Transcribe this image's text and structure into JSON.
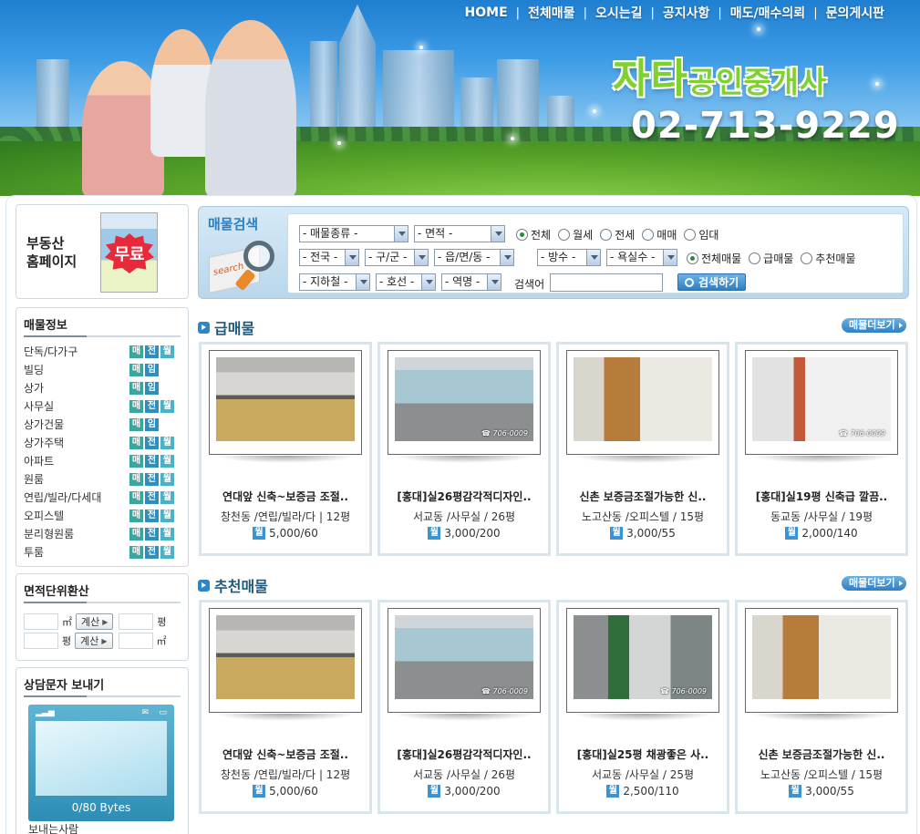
{
  "nav": [
    "HOME",
    "전체매물",
    "오시는길",
    "공지사항",
    "매도/매수의뢰",
    "문의게시판"
  ],
  "brand": {
    "name_big": "자타",
    "name_small": "공인중개사",
    "phone": "02-713-9229"
  },
  "promo": {
    "line1": "부동산",
    "line2": "홈페이지",
    "badge": "무료"
  },
  "info": {
    "title": "매물정보",
    "items": [
      {
        "label": "단독/다가구",
        "tags": [
          "매",
          "전",
          "월"
        ]
      },
      {
        "label": "빌딩",
        "tags": [
          "매",
          "임"
        ]
      },
      {
        "label": "상가",
        "tags": [
          "매",
          "임"
        ]
      },
      {
        "label": "사무실",
        "tags": [
          "매",
          "전",
          "월"
        ]
      },
      {
        "label": "상가건물",
        "tags": [
          "매",
          "임"
        ]
      },
      {
        "label": "상가주택",
        "tags": [
          "매",
          "전",
          "월"
        ]
      },
      {
        "label": "아파트",
        "tags": [
          "매",
          "전",
          "월"
        ]
      },
      {
        "label": "원룸",
        "tags": [
          "매",
          "전",
          "월"
        ]
      },
      {
        "label": "연립/빌라/다세대",
        "tags": [
          "매",
          "전",
          "월"
        ]
      },
      {
        "label": "오피스텔",
        "tags": [
          "매",
          "전",
          "월"
        ]
      },
      {
        "label": "분리형원룸",
        "tags": [
          "매",
          "전",
          "월"
        ]
      },
      {
        "label": "투룸",
        "tags": [
          "매",
          "전",
          "월"
        ]
      }
    ]
  },
  "converter": {
    "title": "면적단위환산",
    "unit_m2": "㎡",
    "unit_py": "평",
    "calc": "계산"
  },
  "sms": {
    "title": "상담문자 보내기",
    "bytes": "0/80 Bytes",
    "sender": "보내는사람"
  },
  "search": {
    "title": "매물검색",
    "art_text": "search",
    "selects_row1": [
      "- 매물종류 -",
      "- 면적 -"
    ],
    "radios_row1": [
      {
        "label": "전체",
        "on": true
      },
      {
        "label": "월세",
        "on": false
      },
      {
        "label": "전세",
        "on": false
      },
      {
        "label": "매매",
        "on": false
      },
      {
        "label": "임대",
        "on": false
      }
    ],
    "selects_row2": [
      "- 전국 -",
      "- 구/군 -",
      "- 읍/면/동 -",
      "- 방수 -",
      "- 욕실수 -"
    ],
    "radios_row2": [
      {
        "label": "전체매물",
        "on": true
      },
      {
        "label": "급매물",
        "on": false
      },
      {
        "label": "추천매물",
        "on": false
      }
    ],
    "selects_row3": [
      "- 지하철 -",
      "- 호선 -",
      "- 역명 -"
    ],
    "keyword_label": "검색어",
    "button": "검색하기"
  },
  "sections": [
    {
      "title": "급매물",
      "more": "매물더보기",
      "cards": [
        {
          "photo": "ph-kitchen",
          "title": "연대앞 신축~보증금 조절..",
          "loc": "창천동 /연립/빌라/다 | 12평",
          "tag": "월",
          "price": "5,000/60"
        },
        {
          "photo": "ph-office",
          "title": "[홍대]실26평감각적디자인..",
          "loc": "서교동 /사무실 / 26평",
          "tag": "월",
          "price": "3,000/200",
          "wm": "☎ 706-0009"
        },
        {
          "photo": "ph-room",
          "title": "신촌 보증금조절가능한 신..",
          "loc": "노고산동 /오피스텔 / 15평",
          "tag": "월",
          "price": "3,000/55"
        },
        {
          "photo": "ph-hall",
          "title": "[홍대]실19평 신축급 깔끔..",
          "loc": "동교동 /사무실 / 19평",
          "tag": "월",
          "price": "2,000/140",
          "wm": "☎ 706-0009"
        }
      ]
    },
    {
      "title": "추천매물",
      "more": "매물더보기",
      "cards": [
        {
          "photo": "ph-kitchen",
          "title": "연대앞 신축~보증금 조절..",
          "loc": "창천동 /연립/빌라/다 | 12평",
          "tag": "월",
          "price": "5,000/60"
        },
        {
          "photo": "ph-office",
          "title": "[홍대]실26평감각적디자인..",
          "loc": "서교동 /사무실 / 26평",
          "tag": "월",
          "price": "3,000/200",
          "wm": "☎ 706-0009"
        },
        {
          "photo": "ph-green",
          "title": "[홍대]실25평 채광좋은 사..",
          "loc": "서교동 /사무실 / 25평",
          "tag": "월",
          "price": "2,500/110",
          "wm": "☎ 706-0009"
        },
        {
          "photo": "ph-room",
          "title": "신촌 보증금조절가능한 신..",
          "loc": "노고산동 /오피스텔 / 15평",
          "tag": "월",
          "price": "3,000/55"
        }
      ]
    }
  ]
}
